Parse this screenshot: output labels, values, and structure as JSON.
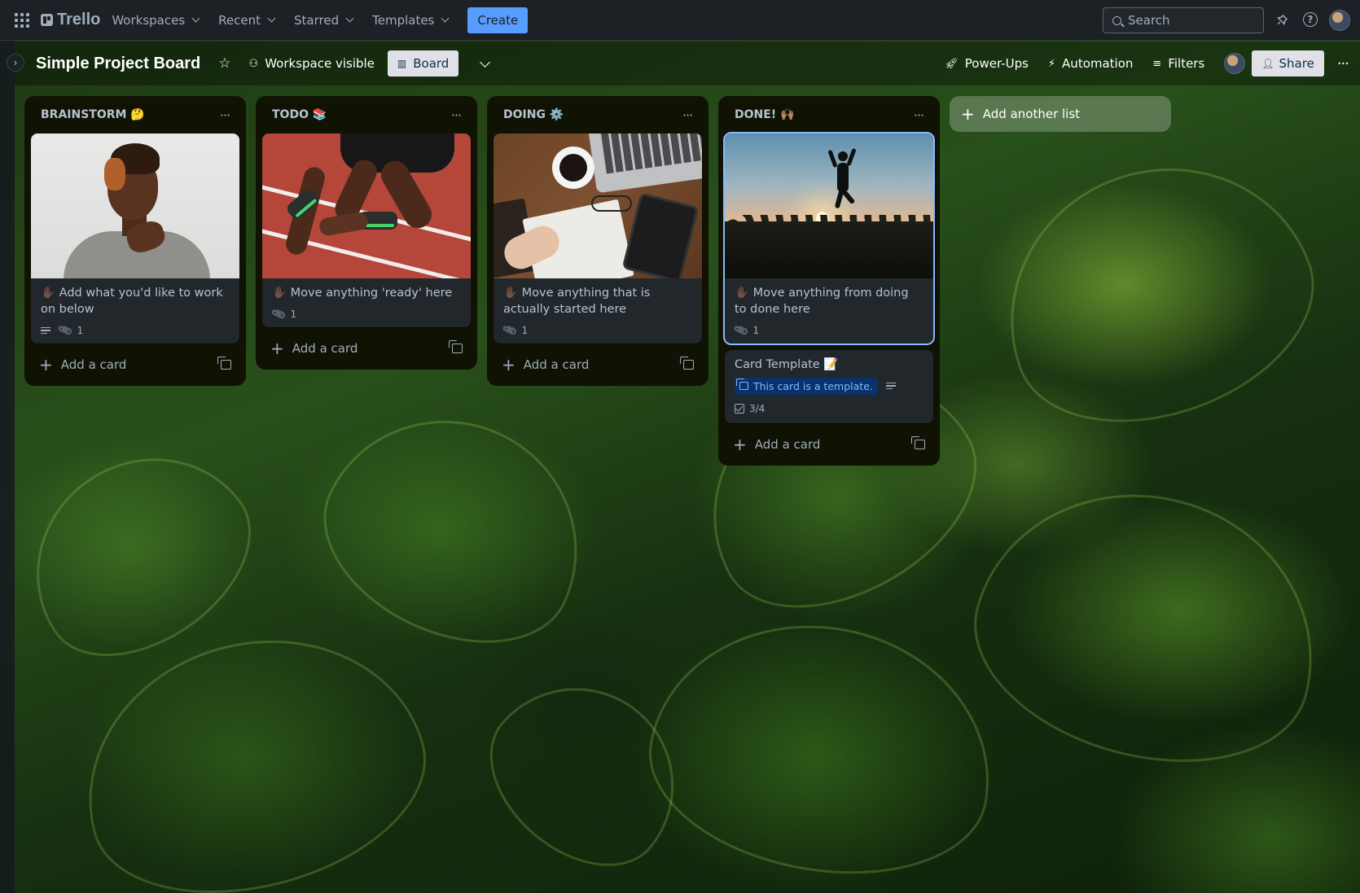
{
  "topbar": {
    "logo": "Trello",
    "nav": [
      {
        "label": "Workspaces"
      },
      {
        "label": "Recent"
      },
      {
        "label": "Starred"
      },
      {
        "label": "Templates"
      }
    ],
    "create_label": "Create",
    "search_placeholder": "Search"
  },
  "board": {
    "title": "Simple Project Board",
    "visibility": "Workspace visible",
    "view_label": "Board",
    "power_ups": "Power-Ups",
    "automation": "Automation",
    "filters": "Filters",
    "share": "Share"
  },
  "lists": [
    {
      "title": "BRAINSTORM 🤔",
      "cards": [
        {
          "title": "✋🏿 Add what you'd like to work on below",
          "attachments": "1",
          "has_description": true
        }
      ],
      "add_card": "Add a card"
    },
    {
      "title": "TODO 📚",
      "cards": [
        {
          "title": "✋🏿 Move anything 'ready' here",
          "attachments": "1"
        }
      ],
      "add_card": "Add a card"
    },
    {
      "title": "DOING ⚙️",
      "cards": [
        {
          "title": "✋🏿 Move anything that is actually started here",
          "attachments": "1"
        }
      ],
      "add_card": "Add a card"
    },
    {
      "title": "DONE! 🙌🏽",
      "cards": [
        {
          "title": "✋🏿 Move anything from doing to done here",
          "attachments": "1"
        },
        {
          "title": "Card Template 📝",
          "template_badge": "This card is a template.",
          "checklist": "3/4",
          "has_description": true
        }
      ],
      "add_card": "Add a card"
    }
  ],
  "add_list_label": "Add another list",
  "colors": {
    "accent": "#579dff",
    "header_bg": "#1d2125",
    "list_bg": "#101204",
    "card_bg": "#22272b",
    "template_badge_bg": "#09326c",
    "template_badge_text": "#85b8ff"
  }
}
